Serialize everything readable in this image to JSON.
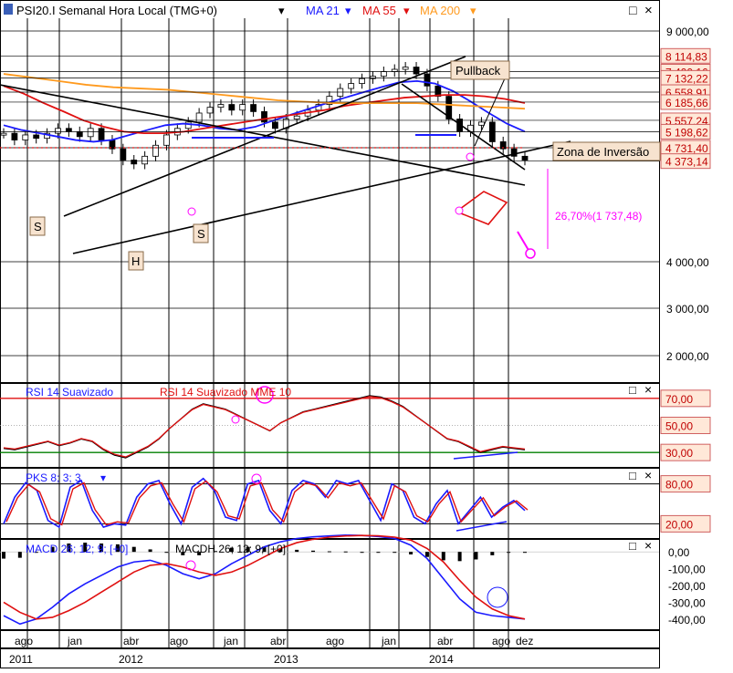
{
  "header": {
    "symbol": "PSI20.I Semanal Hora Local (TMG+0)",
    "ma21": "MA 21",
    "ma55": "MA 55",
    "ma200": "MA 200",
    "dropdown_glyph": "▾",
    "window_controls": {
      "restore": "□",
      "close": "×"
    }
  },
  "colors": {
    "background": "#ffffff",
    "grid": "#000000",
    "bull_candle": "#ffffff",
    "bear_candle": "#000000",
    "ma21": "#1a1aff",
    "ma55": "#e01010",
    "ma200": "#ff9a1e",
    "price_label_bg": "#ffe8d8",
    "price_label_border": "#d06060",
    "rsi_line": "#000000",
    "rsi_signal": "#e01010",
    "pks_fast": "#1a1aff",
    "pks_slow": "#e01010",
    "macd_line": "#1a1aff",
    "macd_signal": "#e01010",
    "annotation_magenta": "#ff00ff",
    "trendline": "#000000",
    "divergence": "#1a1aff"
  },
  "main_axis_labels": [
    "9 000,00",
    "4 000,00",
    "3 000,00",
    "2 000,00"
  ],
  "price_labels": [
    "8 114,83",
    "7 400,16",
    "7 132,22",
    "6 558,91",
    "6 185,66",
    "5 557,24",
    "5 198,62",
    "4 731,40",
    "4 373,14"
  ],
  "annotations": {
    "pullback": "Pullback",
    "zona_inversao": "Zona de Inversão",
    "pct_move": "26,70%(1 737,48)",
    "shoulder_left": "S",
    "shoulder_right": "S",
    "head": "H"
  },
  "rsi_panel": {
    "title": "RSI 14 Suavizado",
    "signal_title": "RSI 14 Suavizado MME 10",
    "axis_labels": [
      "70,00",
      "50,00",
      "30,00"
    ]
  },
  "pks_panel": {
    "title": "PKS 8; 3; 3",
    "axis_labels": [
      "80,00",
      "20,00"
    ]
  },
  "macd_panel": {
    "title": "MACD 26; 12; 9; [+0]",
    "hist_title": "MACDH 26; 12; 9; [+0]",
    "axis_labels": [
      "0,00",
      "-100,00",
      "-200,00",
      "-300,00",
      "-400,00"
    ]
  },
  "time_axis": {
    "months": [
      "ago",
      "jan",
      "abr",
      "ago",
      "jan",
      "abr",
      "ago",
      "jan",
      "abr",
      "ago",
      "dez"
    ],
    "years": [
      "2011",
      "2012",
      "2013",
      "2014"
    ]
  },
  "chart_data": {
    "type": "candlestick",
    "title": "PSI20.I Semanal Hora Local (TMG+0)",
    "period": "weekly",
    "x_start": "2011-06",
    "x_end": "2014-12",
    "ylim_main": [
      1200,
      9700
    ],
    "price_scale": "log",
    "close_approx": [
      5150,
      4950,
      5100,
      5000,
      5150,
      5300,
      5200,
      5050,
      5300,
      4950,
      4700,
      4400,
      4300,
      4500,
      4800,
      5100,
      5300,
      5500,
      5800,
      6000,
      6100,
      5900,
      6100,
      5850,
      5500,
      5300,
      5600,
      5700,
      5900,
      6100,
      6400,
      6700,
      6900,
      7100,
      7200,
      7400,
      7500,
      7600,
      7300,
      6800,
      6400,
      5600,
      5200,
      5400,
      5500,
      4900,
      4700,
      4500,
      4400
    ],
    "series": [
      {
        "name": "MA 21",
        "values": [
          5400,
          5250,
          5150,
          5050,
          4950,
          4900,
          4950,
          5100,
          5250,
          5400,
          5450,
          5400,
          5300,
          5250,
          5350,
          5550,
          5750,
          5950,
          6150,
          6350,
          6550,
          6750,
          6950,
          7000,
          6900,
          6600,
          6200,
          5800,
          5450,
          5200
        ]
      },
      {
        "name": "MA 55",
        "values": [
          6800,
          6500,
          6150,
          5850,
          5550,
          5350,
          5200,
          5150,
          5150,
          5200,
          5300,
          5400,
          5500,
          5600,
          5700,
          5800,
          5900,
          6050,
          6150,
          6250,
          6350,
          6400,
          6450,
          6450,
          6400,
          6300,
          6150
        ]
      },
      {
        "name": "MA 200",
        "values": [
          7300,
          7150,
          7000,
          6850,
          6750,
          6700,
          6650,
          6550,
          6450,
          6350,
          6250,
          6200,
          6150,
          6150,
          6150,
          6150,
          6100,
          6050,
          6000,
          5950
        ]
      }
    ],
    "horizontal_levels": [
      8114.83,
      7400.16,
      7132.22,
      6558.91,
      6185.66,
      5557.24,
      5198.62,
      4731.4,
      4373.14
    ],
    "pct_move": "26,70%(1 737,48)",
    "rsi": {
      "name": "RSI 14 Suavizado",
      "ylim": [
        20,
        80
      ],
      "levels": [
        70,
        50,
        30
      ],
      "values": [
        33,
        32,
        34,
        36,
        38,
        35,
        37,
        40,
        38,
        32,
        28,
        26,
        30,
        34,
        40,
        48,
        55,
        62,
        66,
        64,
        62,
        58,
        54,
        50,
        46,
        52,
        56,
        60,
        62,
        64,
        66,
        68,
        70,
        72,
        71,
        68,
        64,
        58,
        52,
        46,
        40,
        38,
        34,
        30,
        32,
        34,
        33,
        32
      ]
    },
    "pks": {
      "name": "PKS 8; 3; 3",
      "ylim": [
        0,
        100
      ],
      "levels": [
        80,
        20
      ],
      "values": [
        20,
        60,
        82,
        70,
        25,
        15,
        75,
        85,
        40,
        15,
        20,
        18,
        60,
        80,
        85,
        50,
        20,
        75,
        88,
        70,
        30,
        25,
        80,
        85,
        40,
        20,
        70,
        85,
        80,
        60,
        85,
        80,
        85,
        55,
        25,
        80,
        70,
        30,
        20,
        50,
        70,
        20,
        40,
        60,
        30,
        45,
        55,
        40
      ]
    },
    "macd": {
      "name": "MACD 26; 12; 9; [+0]",
      "ylim": [
        -450,
        50
      ],
      "macd_values": [
        -380,
        -430,
        -400,
        -330,
        -250,
        -190,
        -140,
        -90,
        -60,
        -50,
        -80,
        -130,
        -160,
        -130,
        -70,
        -20,
        30,
        60,
        80,
        90,
        95,
        100,
        98,
        92,
        80,
        40,
        -40,
        -160,
        -280,
        -360,
        -380,
        -390,
        -400
      ],
      "signal_values": [
        -300,
        -360,
        -400,
        -390,
        -350,
        -300,
        -240,
        -180,
        -120,
        -80,
        -70,
        -90,
        -120,
        -140,
        -120,
        -80,
        -30,
        20,
        55,
        75,
        88,
        95,
        98,
        96,
        88,
        70,
        20,
        -60,
        -170,
        -270,
        -340,
        -380,
        -400
      ]
    }
  }
}
